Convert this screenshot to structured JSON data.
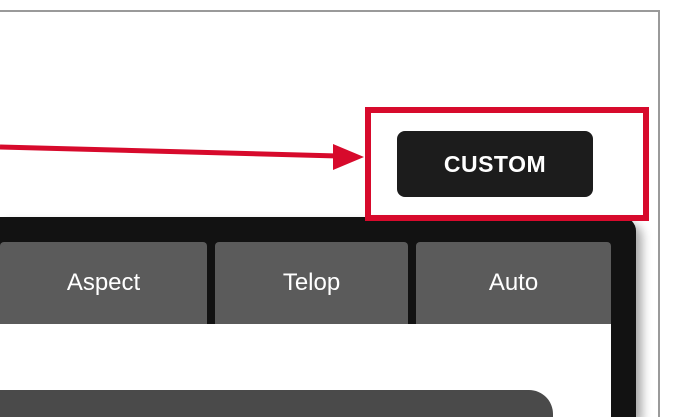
{
  "custom_button": {
    "label": "CUSTOM"
  },
  "tabs": [
    {
      "label": "Aspect"
    },
    {
      "label": "Telop"
    },
    {
      "label": "Auto"
    }
  ],
  "colors": {
    "highlight": "#d70a2c",
    "button_bg": "#1c1c1c",
    "panel_bg": "#121212",
    "tab_bg": "#5b5b5b"
  }
}
